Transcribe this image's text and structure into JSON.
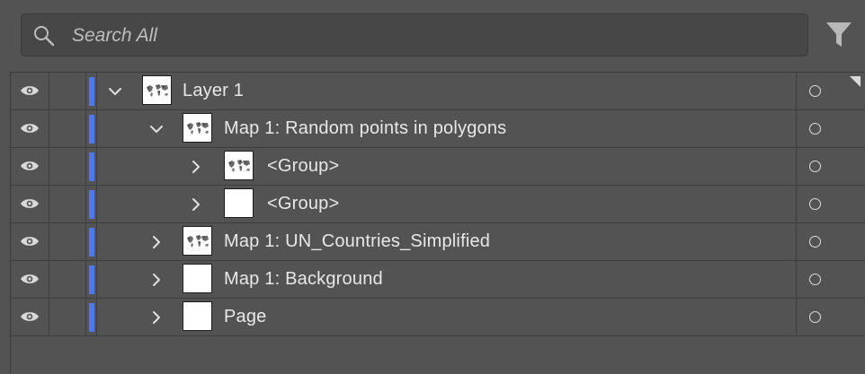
{
  "search": {
    "placeholder": "Search All"
  },
  "icons": {
    "search": "magnifier-icon",
    "filter": "funnel-icon",
    "visibility": "eye-icon",
    "expand": "chevron-right-icon",
    "collapse": "chevron-down-icon",
    "target": "target-circle-icon"
  },
  "colors": {
    "layer_color": "#4f78f0",
    "panel_bg": "#535353",
    "search_bg": "#474747"
  },
  "layers": [
    {
      "label": "Layer 1",
      "depth": 0,
      "expanded": true,
      "thumb": "map"
    },
    {
      "label": "Map 1: Random points in polygons",
      "depth": 1,
      "expanded": true,
      "thumb": "map"
    },
    {
      "label": "<Group>",
      "depth": 2,
      "expanded": false,
      "thumb": "map"
    },
    {
      "label": "<Group>",
      "depth": 2,
      "expanded": false,
      "thumb": "blank"
    },
    {
      "label": "Map 1: UN_Countries_Simplified",
      "depth": 1,
      "expanded": false,
      "thumb": "map"
    },
    {
      "label": "Map 1: Background",
      "depth": 1,
      "expanded": false,
      "thumb": "blank"
    },
    {
      "label": "Page",
      "depth": 1,
      "expanded": false,
      "thumb": "blank"
    }
  ]
}
